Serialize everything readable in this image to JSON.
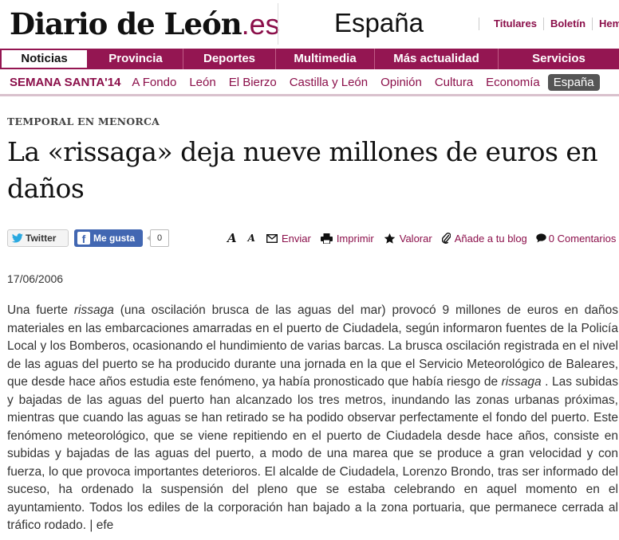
{
  "brand": {
    "logo_main": "Diario de León",
    "logo_tld": ".es",
    "edition": "España"
  },
  "top_links": [
    "Titulares",
    "Boletín",
    "Hem"
  ],
  "nav_primary": [
    {
      "label": "Noticias",
      "active": true
    },
    {
      "label": "Provincia",
      "active": false
    },
    {
      "label": "Deportes",
      "active": false
    },
    {
      "label": "Multimedia",
      "active": false
    },
    {
      "label": "Más actualidad",
      "active": false
    },
    {
      "label": "Servicios",
      "active": false
    }
  ],
  "nav_secondary": [
    {
      "label": "SEMANA SANTA'14",
      "special": true
    },
    {
      "label": "A Fondo"
    },
    {
      "label": "León"
    },
    {
      "label": "El Bierzo"
    },
    {
      "label": "Castilla y León"
    },
    {
      "label": "Opinión"
    },
    {
      "label": "Cultura"
    },
    {
      "label": "Economía"
    },
    {
      "label": "España",
      "active": true
    }
  ],
  "article": {
    "kicker": "TEMPORAL EN MENORCA",
    "headline": "La «rissaga» deja nueve millones de euros en daños",
    "date": "17/06/2006",
    "body_parts": [
      {
        "text": "Una fuerte ",
        "italic": false
      },
      {
        "text": "rissaga",
        "italic": true
      },
      {
        "text": " (una oscilación brusca de las aguas del mar) provocó 9 millones de euros en daños materiales en las embarcaciones amarradas en el puerto de Ciudadela, según informaron fuentes de la Policía Local y los Bomberos, ocasionando el hundimiento de varias barcas. La brusca oscilación registrada en el nivel de las aguas del puerto se ha producido durante una jornada en la que el Servicio Meteorológico de Baleares, que desde hace años estudia este fenómeno, ya había pronosticado que había riesgo de ",
        "italic": false
      },
      {
        "text": "rissaga",
        "italic": true
      },
      {
        "text": " . Las subidas y bajadas de las aguas del puerto han alcanzado los tres metros, inundando las zonas urbanas próximas, mientras que cuando las aguas se han retirado se ha podido observar perfectamente el fondo del puerto. Este fenómeno meteorológico, que se viene repitiendo en el puerto de Ciudadela desde hace años, consiste en subidas y bajadas de las aguas del puerto, a modo de una marea que se produce a gran velocidad y con fuerza, lo que provoca importantes deterioros. El alcalde de Ciudadela, Lorenzo Brondo, tras ser informado del suceso, ha ordenado la suspensión del pleno que se estaba celebrando en aquel momento en el ayuntamiento. Todos los ediles de la corporación han bajado a la zona portuaria, que permanece cerrada al tráfico rodado. | efe",
        "italic": false
      }
    ]
  },
  "share": {
    "twitter_label": "Twitter",
    "fb_label": "Me gusta",
    "fb_count": "0"
  },
  "tools": {
    "font_up": "A",
    "font_down": "A",
    "send": "Enviar",
    "print": "Imprimir",
    "rate": "Valorar",
    "blog": "Añade a tu blog",
    "comments": "0 Comentarios"
  },
  "colors": {
    "brand": "#941652",
    "link": "#8b0f4a",
    "facebook": "#4267b2"
  }
}
